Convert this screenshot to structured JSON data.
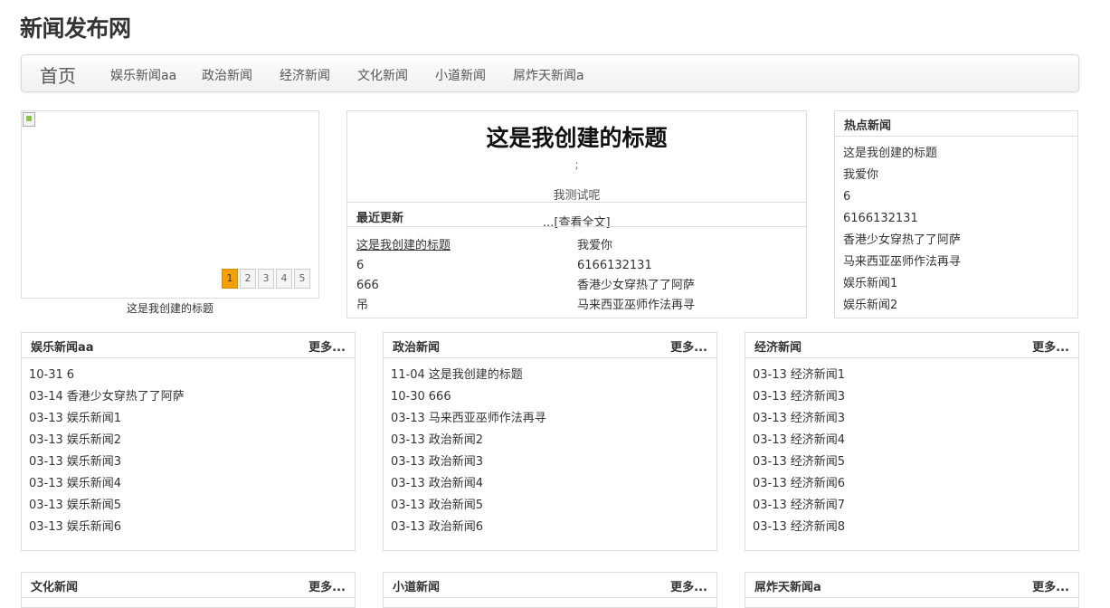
{
  "site": {
    "title": "新闻发布网"
  },
  "nav": {
    "brand": "首页",
    "items": [
      "娱乐新闻aa",
      "政治新闻",
      "经济新闻",
      "文化新闻",
      "小道新闻",
      "屌炸天新闻a"
    ]
  },
  "slider": {
    "caption": "这是我创建的标题",
    "pages": [
      "1",
      "2",
      "3",
      "4",
      "5"
    ],
    "active_page": "1"
  },
  "feature": {
    "title": "这是我创建的标题",
    "semicolon": ";",
    "summary": "我测试呢",
    "recent_label": "最近更新",
    "more_link": "...[查看全文]",
    "recent_items": [
      "这是我创建的标题",
      "我爱你",
      "6",
      "6166132131",
      "666",
      "香港少女穿热了了阿萨",
      "吊",
      "马来西亚巫师作法再寻"
    ]
  },
  "hot": {
    "title": "热点新闻",
    "items": [
      "这是我创建的标题",
      "我爱你",
      "6",
      "6166132131",
      "香港少女穿热了了阿萨",
      "马来西亚巫师作法再寻",
      "娱乐新闻1",
      "娱乐新闻2"
    ]
  },
  "categories": [
    {
      "title": "娱乐新闻aa",
      "more": "更多...",
      "items": [
        {
          "date": "10-31",
          "text": "6"
        },
        {
          "date": "03-14",
          "text": "香港少女穿热了了阿萨"
        },
        {
          "date": "03-13",
          "text": "娱乐新闻1"
        },
        {
          "date": "03-13",
          "text": "娱乐新闻2"
        },
        {
          "date": "03-13",
          "text": "娱乐新闻3"
        },
        {
          "date": "03-13",
          "text": "娱乐新闻4"
        },
        {
          "date": "03-13",
          "text": "娱乐新闻5"
        },
        {
          "date": "03-13",
          "text": "娱乐新闻6"
        }
      ]
    },
    {
      "title": "政治新闻",
      "more": "更多...",
      "items": [
        {
          "date": "11-04",
          "text": "这是我创建的标题"
        },
        {
          "date": "10-30",
          "text": "666"
        },
        {
          "date": "03-13",
          "text": "马来西亚巫师作法再寻"
        },
        {
          "date": "03-13",
          "text": "政治新闻2"
        },
        {
          "date": "03-13",
          "text": "政治新闻3"
        },
        {
          "date": "03-13",
          "text": "政治新闻4"
        },
        {
          "date": "03-13",
          "text": "政治新闻5"
        },
        {
          "date": "03-13",
          "text": "政治新闻6"
        }
      ]
    },
    {
      "title": "经济新闻",
      "more": "更多...",
      "items": [
        {
          "date": "03-13",
          "text": "经济新闻1"
        },
        {
          "date": "03-13",
          "text": "经济新闻3"
        },
        {
          "date": "03-13",
          "text": "经济新闻3"
        },
        {
          "date": "03-13",
          "text": "经济新闻4"
        },
        {
          "date": "03-13",
          "text": "经济新闻5"
        },
        {
          "date": "03-13",
          "text": "经济新闻6"
        },
        {
          "date": "03-13",
          "text": "经济新闻7"
        },
        {
          "date": "03-13",
          "text": "经济新闻8"
        }
      ]
    },
    {
      "title": "文化新闻",
      "more": "更多...",
      "items": []
    },
    {
      "title": "小道新闻",
      "more": "更多...",
      "items": []
    },
    {
      "title": "屌炸天新闻a",
      "more": "更多...",
      "items": []
    }
  ]
}
